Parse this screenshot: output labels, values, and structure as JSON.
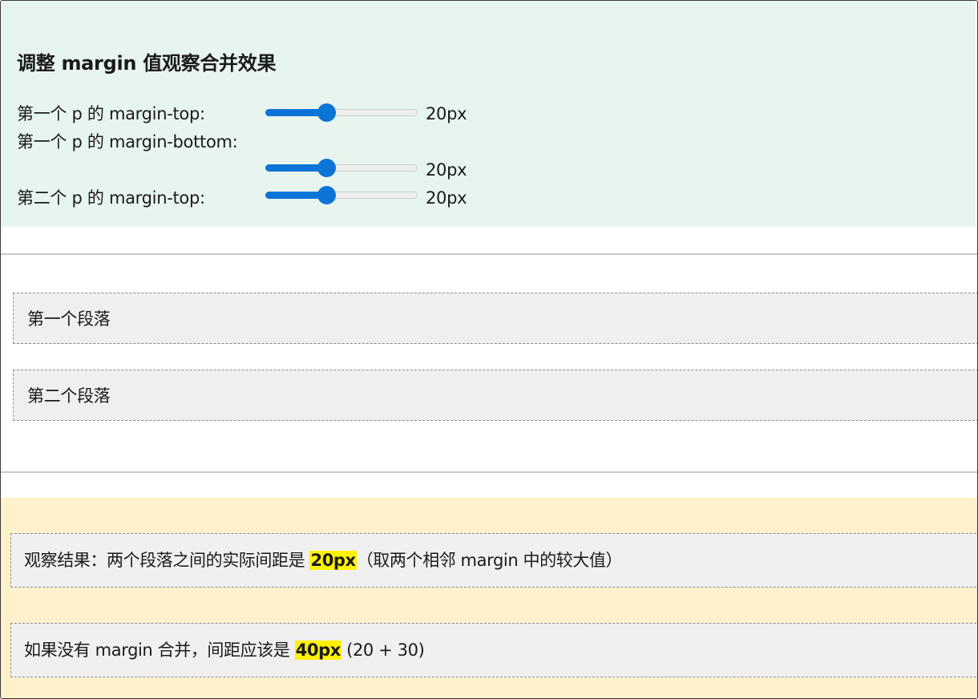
{
  "controls": {
    "title": "调整 margin 值观察合并效果",
    "sliders": [
      {
        "label": "第一个 p 的 margin-top:",
        "value": "20px",
        "level": 0.4
      },
      {
        "label": "第一个 p 的 margin-bottom:",
        "value": "20px",
        "level": 0.4
      },
      {
        "label": "第二个 p 的 margin-top:",
        "value": "20px",
        "level": 0.4
      }
    ]
  },
  "demo": {
    "paragraph1": "第一个段落",
    "paragraph2": "第二个段落"
  },
  "result": {
    "line1_prefix": "观察结果：两个段落之间的实际间距是 ",
    "line1_value": "20px",
    "line1_suffix": "（取两个相邻 margin 中的较大值）",
    "line2_prefix": "如果没有 margin 合并，间距应该是 ",
    "line2_value": "40px",
    "line2_suffix": " (20 + 30)"
  },
  "colors": {
    "accent": "#0b74d6",
    "controls_bg": "#e8f5ee",
    "result_bg": "#fff1cc",
    "highlight": "#fff200"
  }
}
